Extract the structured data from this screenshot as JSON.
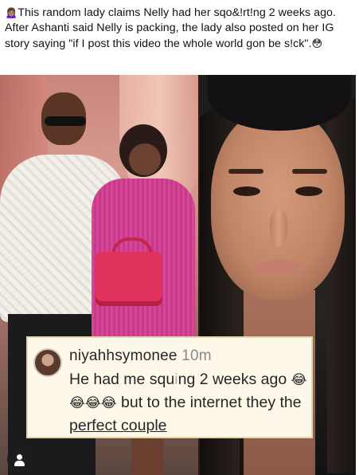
{
  "post": {
    "caption_emoji": "🙍🏽‍♀️",
    "caption_text": "This random lady claims Nelly had her sqo&!rt!ng 2 weeks ago. After Ashanti said Nelly is packing, the lady also posted on her IG story saying \"if I post this video the whole world gon be s!ck\".",
    "caption_end_emoji": "😳"
  },
  "comment": {
    "username": "niyahhsymonee",
    "time": "10m",
    "text_before": "He had me squ",
    "text_obscured": "i",
    "text_after": "ng 2 weeks ago",
    "emojis": "😂😂😂😂",
    "text_tail": "but to the internet they the ",
    "text_underlined": "perfect couple"
  },
  "icons": {
    "privacy": "user-icon"
  }
}
